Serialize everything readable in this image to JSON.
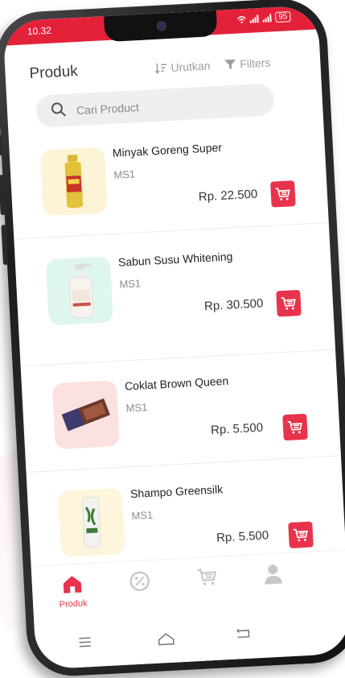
{
  "status": {
    "time": "10.32",
    "battery": "95"
  },
  "header": {
    "title": "Produk",
    "sort_label": "Urutkan",
    "filter_label": "Filters"
  },
  "search": {
    "placeholder": "Cari Product"
  },
  "products": [
    {
      "name": "Minyak Goreng Super",
      "code": "MS1",
      "price": "Rp. 22.500"
    },
    {
      "name": "Sabun Susu Whitening",
      "code": "MS1",
      "price": "Rp. 30.500"
    },
    {
      "name": "Coklat Brown Queen",
      "code": "MS1",
      "price": "Rp. 5.500"
    },
    {
      "name": "Shampo Greensilk",
      "code": "MS1",
      "price": "Rp. 5.500"
    }
  ],
  "nav": {
    "home_label": "Produk"
  },
  "colors": {
    "accent": "#e8334c",
    "statusbar": "#e3223a",
    "inactive_icon": "#c8c8c8"
  },
  "icons": [
    "search-icon",
    "sort-icon",
    "filter-icon",
    "cart-icon",
    "home-icon",
    "discount-icon",
    "profile-icon"
  ]
}
